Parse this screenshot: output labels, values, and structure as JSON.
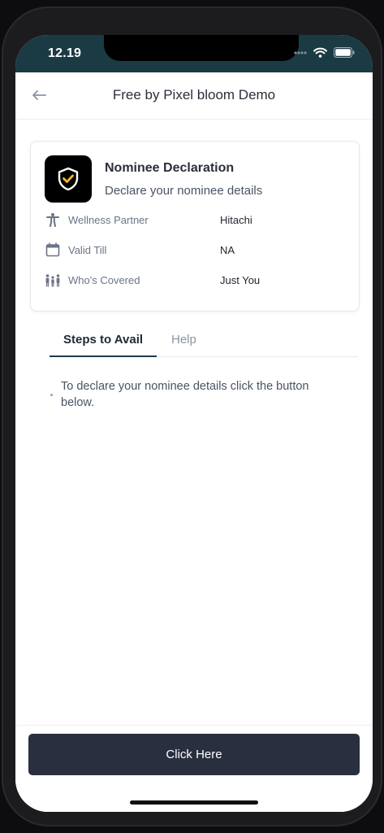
{
  "status_bar": {
    "time": "12.19",
    "icons": [
      "signal-dots-icon",
      "wifi-icon",
      "battery-icon"
    ]
  },
  "header": {
    "back_icon": "arrow-left-icon",
    "title": "Free by Pixel bloom Demo"
  },
  "card": {
    "badge_icon": "shield-check-icon",
    "title": "Nominee Declaration",
    "subtitle": "Declare your nominee details",
    "rows": [
      {
        "icon": "person-icon",
        "label": "Wellness Partner",
        "value": "Hitachi"
      },
      {
        "icon": "calendar-icon",
        "label": "Valid Till",
        "value": "NA"
      },
      {
        "icon": "family-icon",
        "label": "Who's Covered",
        "value": "Just You"
      }
    ]
  },
  "tabs": [
    {
      "label": "Steps to Avail",
      "active": true
    },
    {
      "label": "Help",
      "active": false
    }
  ],
  "steps": [
    "To declare your nominee details click the button below."
  ],
  "footer": {
    "cta_label": "Click Here"
  },
  "colors": {
    "status_bar": "#1a3a44",
    "cta_background": "#2a2f3f",
    "tab_underline": "#1f3b4a"
  }
}
